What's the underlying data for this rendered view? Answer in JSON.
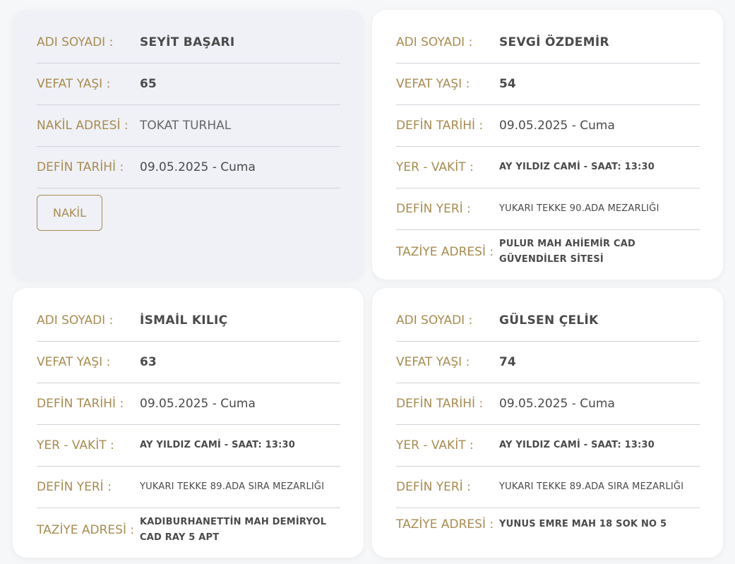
{
  "labels": {
    "name": "ADI SOYADI :",
    "age": "VEFAT YAŞI :",
    "transfer": "NAKİL ADRESİ :",
    "burial_date": "DEFİN TARİHİ :",
    "place_time": "YER - VAKİT :",
    "burial_place": "DEFİN YERİ :",
    "condolence": "TAZİYE ADRESİ :"
  },
  "cards": [
    {
      "name": "SEYİT BAŞARI",
      "age": "65",
      "transfer": "TOKAT TURHAL",
      "burial_date": "09.05.2025 - Cuma",
      "button": "NAKİL"
    },
    {
      "name": "SEVGİ ÖZDEMİR",
      "age": "54",
      "burial_date": "09.05.2025 - Cuma",
      "place_time": "AY YILDIZ CAMİ - SAAT: 13:30",
      "burial_place": "YUKARI TEKKE 90.ADA MEZARLIĞI",
      "condolence": "PULUR MAH AHİEMİR CAD GÜVENDİLER SİTESİ"
    },
    {
      "name": "İSMAİL KILIÇ",
      "age": "63",
      "burial_date": "09.05.2025 - Cuma",
      "place_time": "AY YILDIZ CAMİ - SAAT: 13:30",
      "burial_place": "YUKARI TEKKE 89.ADA SIRA MEZARLIĞI",
      "condolence": "KADIBURHANETTİN MAH DEMİRYOL CAD RAY 5 APT"
    },
    {
      "name": "GÜLSEN ÇELİK",
      "age": "74",
      "burial_date": "09.05.2025 - Cuma",
      "place_time": "AY YILDIZ CAMİ - SAAT: 13:30",
      "burial_place": "YUKARI TEKKE 89.ADA SIRA MEZARLIĞI",
      "condolence": "YUNUS EMRE MAH 18 SOK NO 5"
    }
  ]
}
